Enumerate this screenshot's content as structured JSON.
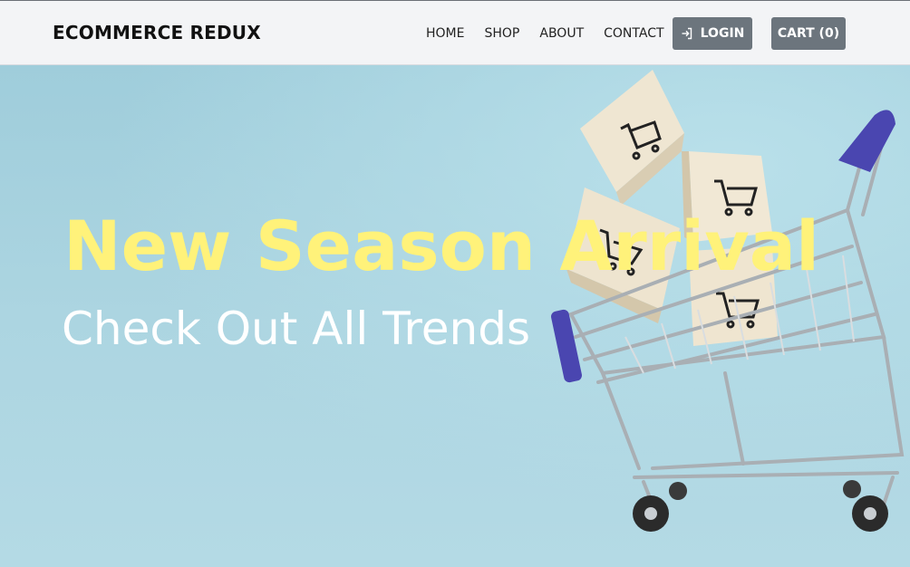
{
  "navbar": {
    "brand": "ECOMMERCE REDUX",
    "links": [
      {
        "label": "HOME"
      },
      {
        "label": "SHOP"
      },
      {
        "label": "ABOUT"
      },
      {
        "label": "CONTACT"
      }
    ],
    "login_label": "LOGIN",
    "login_icon": "login-icon",
    "cart_label": "CART (0)"
  },
  "hero": {
    "title": "New Season Arrival",
    "subtitle": "Check Out All Trends",
    "image_icon": "shopping-cart-with-boxes",
    "colors": {
      "title": "#fff27a",
      "subtitle": "#ffffff",
      "background": "#aed6e2",
      "button": "#6c757d"
    }
  }
}
